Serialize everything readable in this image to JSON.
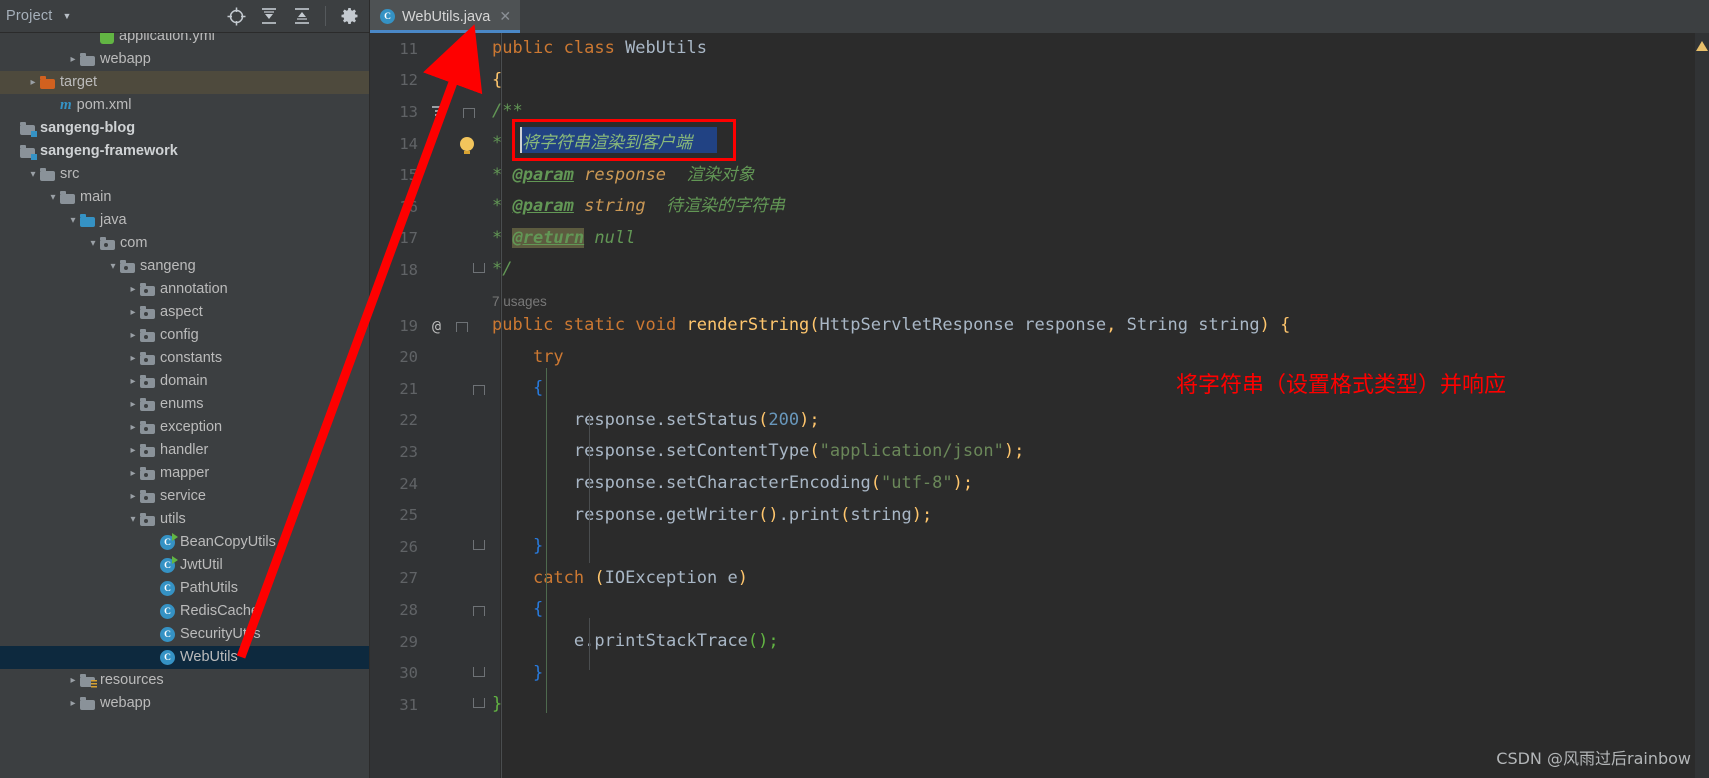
{
  "project_panel": {
    "title": "Project",
    "caret_icon": "chevron-down-icon",
    "toolbar_icons": [
      "locate-icon",
      "expand-all-icon",
      "collapse-all-icon",
      "gear-icon"
    ],
    "minimize_icon": "minimize-icon",
    "tree": [
      {
        "label": "application.yml",
        "indent": 4,
        "arrow": "",
        "icon": "yml-file-icon",
        "state": "partial"
      },
      {
        "label": "webapp",
        "indent": 3,
        "arrow": "›",
        "icon": "folder-icon",
        "state": "normal"
      },
      {
        "label": "target",
        "indent": 1,
        "arrow": "›",
        "icon": "folder-target-icon",
        "state": "selected-inactive"
      },
      {
        "label": "pom.xml",
        "indent": 2,
        "arrow": "",
        "icon": "maven-icon",
        "state": "normal"
      },
      {
        "label": "sangeng-blog",
        "indent": 0,
        "arrow": "",
        "icon": "module-icon",
        "state": "bold"
      },
      {
        "label": "sangeng-framework",
        "indent": 0,
        "arrow": "",
        "icon": "module-icon",
        "state": "bold"
      },
      {
        "label": "src",
        "indent": 1,
        "arrow": "⌄",
        "icon": "folder-icon",
        "state": "normal"
      },
      {
        "label": "main",
        "indent": 2,
        "arrow": "⌄",
        "icon": "folder-icon",
        "state": "normal"
      },
      {
        "label": "java",
        "indent": 3,
        "arrow": "⌄",
        "icon": "source-root-folder-icon",
        "state": "normal"
      },
      {
        "label": "com",
        "indent": 4,
        "arrow": "⌄",
        "icon": "package-icon",
        "state": "normal"
      },
      {
        "label": "sangeng",
        "indent": 5,
        "arrow": "⌄",
        "icon": "package-icon",
        "state": "normal"
      },
      {
        "label": "annotation",
        "indent": 6,
        "arrow": "›",
        "icon": "package-icon",
        "state": "normal"
      },
      {
        "label": "aspect",
        "indent": 6,
        "arrow": "›",
        "icon": "package-icon",
        "state": "normal"
      },
      {
        "label": "config",
        "indent": 6,
        "arrow": "›",
        "icon": "package-icon",
        "state": "normal"
      },
      {
        "label": "constants",
        "indent": 6,
        "arrow": "›",
        "icon": "package-icon",
        "state": "normal"
      },
      {
        "label": "domain",
        "indent": 6,
        "arrow": "›",
        "icon": "package-icon",
        "state": "normal"
      },
      {
        "label": "enums",
        "indent": 6,
        "arrow": "›",
        "icon": "package-icon",
        "state": "normal"
      },
      {
        "label": "exception",
        "indent": 6,
        "arrow": "›",
        "icon": "package-icon",
        "state": "normal"
      },
      {
        "label": "handler",
        "indent": 6,
        "arrow": "›",
        "icon": "package-icon",
        "state": "normal"
      },
      {
        "label": "mapper",
        "indent": 6,
        "arrow": "›",
        "icon": "package-icon",
        "state": "normal"
      },
      {
        "label": "service",
        "indent": 6,
        "arrow": "›",
        "icon": "package-icon",
        "state": "normal"
      },
      {
        "label": "utils",
        "indent": 6,
        "arrow": "⌄",
        "icon": "package-icon",
        "state": "normal"
      },
      {
        "label": "BeanCopyUtils",
        "indent": 7,
        "arrow": "",
        "icon": "java-class-runnable-icon",
        "state": "normal"
      },
      {
        "label": "JwtUtil",
        "indent": 7,
        "arrow": "",
        "icon": "java-class-runnable-icon",
        "state": "normal"
      },
      {
        "label": "PathUtils",
        "indent": 7,
        "arrow": "",
        "icon": "java-class-icon",
        "state": "normal"
      },
      {
        "label": "RedisCache",
        "indent": 7,
        "arrow": "",
        "icon": "java-class-icon",
        "state": "normal"
      },
      {
        "label": "SecurityUtils",
        "indent": 7,
        "arrow": "",
        "icon": "java-class-icon",
        "state": "normal"
      },
      {
        "label": "WebUtils",
        "indent": 7,
        "arrow": "",
        "icon": "java-class-icon",
        "state": "selected-active"
      },
      {
        "label": "resources",
        "indent": 3,
        "arrow": "›",
        "icon": "resources-folder-icon",
        "state": "normal"
      },
      {
        "label": "webapp",
        "indent": 3,
        "arrow": "›",
        "icon": "folder-icon",
        "state": "normal"
      }
    ]
  },
  "editor": {
    "tab": {
      "label": "WebUtils.java",
      "icon": "java-class-icon",
      "close_icon": "close-icon"
    },
    "usages_label": "7 usages",
    "first_line_number": 11,
    "lines": [
      {
        "n": "11",
        "gutter": "",
        "code_html": "<span class='kw'>public class </span><span class='cls-ref' style='color:#a9b7c6'>WebUtils</span>"
      },
      {
        "n": "12",
        "gutter": "",
        "code_html": "<span class='brace-y'>{</span>"
      },
      {
        "n": "13",
        "gutter": "struct-fold-top",
        "code_html": "<span class='cmt'>/**</span>"
      },
      {
        "n": "14",
        "gutter": "bulb",
        "code_html": "<span class='cmt'>* </span>"
      },
      {
        "n": "15",
        "gutter": "",
        "code_html": "<span class='cmt'>* </span><span class='tagj'>@param</span><span class='cmt'> </span><span style='color:#cc9955;font-style:italic'>response</span><span class='cmt'>  渲染对象</span>"
      },
      {
        "n": "16",
        "gutter": "",
        "code_html": "<span class='cmt'>* </span><span class='tagj'>@param</span><span class='cmt'> </span><span style='color:#cc9955;font-style:italic'>string</span><span class='cmt'>  待渲染的字符串</span>"
      },
      {
        "n": "17",
        "gutter": "",
        "code_html": "<span class='cmt'>* </span><span class='tagj hl'>@return</span><span class='cmt'> null</span>"
      },
      {
        "n": "18",
        "gutter": "fold-bot",
        "code_html": "<span class='cmt'>*/</span>"
      },
      {
        "n": "",
        "gutter": "",
        "code_html": "<span class='usages'>7 usages</span>"
      },
      {
        "n": "19",
        "gutter": "at-fold",
        "code_html": "<span class='kw'>public static void </span><span class='mname'>renderString</span><span class='paren'>(</span><span class='cls-ref'>HttpServletResponse response</span><span class='paren'>,</span><span class='cls-ref'> String string</span><span class='paren'>)</span><span class='cls-ref'> </span><span class='brace-y'>{</span>"
      },
      {
        "n": "20",
        "gutter": "",
        "code_html": "    <span class='kw'>try</span>"
      },
      {
        "n": "21",
        "gutter": "fold-top2",
        "code_html": "    <span class='brace-b'>{</span>"
      },
      {
        "n": "22",
        "gutter": "",
        "code_html": "        <span class='cls-ref'>response</span>.<span class='cls-ref'>setStatus</span><span class='paren'>(</span><span class='num'>200</span><span class='paren'>)</span><span class='paren'>;</span>"
      },
      {
        "n": "23",
        "gutter": "",
        "code_html": "        <span class='cls-ref'>response</span>.<span class='cls-ref'>setContentType</span><span class='paren'>(</span><span class='str'>\"application/json\"</span><span class='paren'>)</span><span class='paren'>;</span>"
      },
      {
        "n": "24",
        "gutter": "",
        "code_html": "        <span class='cls-ref'>response</span>.<span class='cls-ref'>setCharacterEncoding</span><span class='paren'>(</span><span class='str'>\"utf-8\"</span><span class='paren'>)</span><span class='paren'>;</span>"
      },
      {
        "n": "25",
        "gutter": "",
        "code_html": "        <span class='cls-ref'>response</span>.<span class='cls-ref'>getWriter</span><span class='paren'>()</span>.<span class='cls-ref'>print</span><span class='paren'>(</span><span class='cls-ref'>string</span><span class='paren'>)</span><span class='paren'>;</span>"
      },
      {
        "n": "26",
        "gutter": "fold-bot2",
        "code_html": "    <span class='brace-b'>}</span>"
      },
      {
        "n": "27",
        "gutter": "",
        "code_html": "    <span class='kw'>catch </span><span class='paren'>(</span><span class='cls-ref'>IOException e</span><span class='paren'>)</span>"
      },
      {
        "n": "28",
        "gutter": "fold-top3",
        "code_html": "    <span class='brace-b'>{</span>"
      },
      {
        "n": "29",
        "gutter": "",
        "code_html": "        <span class='cls-ref'>e</span>.<span class='cls-ref'>printStackTrace</span><span class='semi-g'>()</span><span class='semi-g'>;</span>"
      },
      {
        "n": "30",
        "gutter": "fold-bot3",
        "code_html": "    <span class='brace-b'>}</span>"
      },
      {
        "n": "31",
        "gutter": "fold-bot4",
        "code_html": "<span class='semi-g'>}</span>"
      }
    ],
    "highlighted_comment": {
      "text": "将字符串渲染到客户端",
      "box_color": "#ff0000",
      "selection_color": "#214283",
      "text_color": "#629755"
    },
    "warning_icon": "warning-triangle-icon"
  },
  "annotations": {
    "red_note": "将字符串（设置格式类型）并响应",
    "red_note_color": "#ff0000",
    "arrow_color": "#fe0000",
    "arrow_from": "WebUtils tree node",
    "arrow_to": "public class WebUtils"
  },
  "watermark": {
    "text": "CSDN @风雨过后rainbow"
  }
}
